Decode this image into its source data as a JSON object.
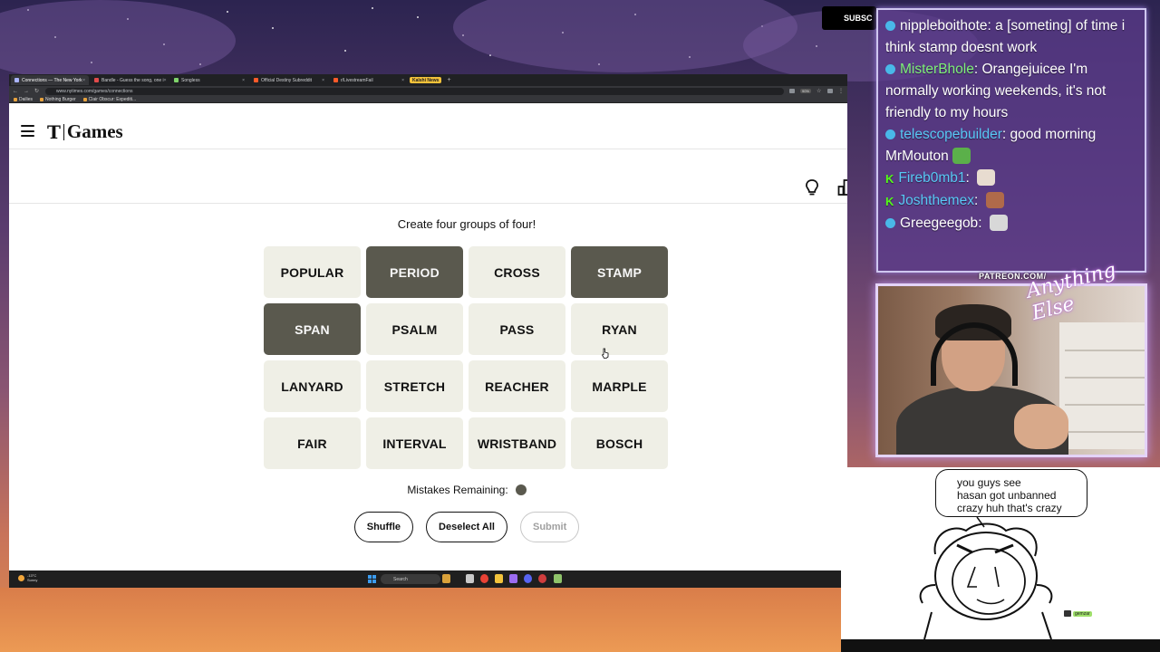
{
  "browser": {
    "tabs": [
      {
        "label": "Connections — The New York",
        "color": "#aab4ff",
        "active": true
      },
      {
        "label": "Bandle - Guess the song, one i",
        "color": "#e14b4b",
        "active": false
      },
      {
        "label": "Songless",
        "color": "#7fd36b",
        "active": false
      },
      {
        "label": "Official Destiny Subreddit",
        "color": "#ff5a2a",
        "active": false
      },
      {
        "label": "r/LivestreamFail",
        "color": "#ff5a2a",
        "active": false
      }
    ],
    "tab_pill": "Kalshi News",
    "url": "www.nytimes.com/games/connections",
    "zoom": "90%",
    "bookmarks": [
      "Dailies",
      "Nothing Burger",
      "Clair Obscur: Expediti..."
    ]
  },
  "header": {
    "logo_t": "T",
    "logo_text": "Games",
    "subscribe": "SUBSC"
  },
  "game": {
    "prompt": "Create four groups of four!",
    "tiles": [
      {
        "word": "POPULAR",
        "selected": false
      },
      {
        "word": "PERIOD",
        "selected": true
      },
      {
        "word": "CROSS",
        "selected": false
      },
      {
        "word": "STAMP",
        "selected": true
      },
      {
        "word": "SPAN",
        "selected": true
      },
      {
        "word": "PSALM",
        "selected": false
      },
      {
        "word": "PASS",
        "selected": false
      },
      {
        "word": "RYAN",
        "selected": false
      },
      {
        "word": "LANYARD",
        "selected": false
      },
      {
        "word": "STRETCH",
        "selected": false
      },
      {
        "word": "REACHER",
        "selected": false
      },
      {
        "word": "MARPLE",
        "selected": false
      },
      {
        "word": "FAIR",
        "selected": false
      },
      {
        "word": "INTERVAL",
        "selected": false
      },
      {
        "word": "WRISTBAND",
        "selected": false
      },
      {
        "word": "BOSCH",
        "selected": false
      }
    ],
    "mistakes_label": "Mistakes Remaining:",
    "mistakes_remaining": 1,
    "buttons": {
      "shuffle": "Shuffle",
      "deselect": "Deselect All",
      "submit": "Submit"
    },
    "selected_color": "#5a594e",
    "tile_color": "#efefe6"
  },
  "taskbar": {
    "temp": "-13°C",
    "weather": "Sunny",
    "search": "Search"
  },
  "chat": {
    "messages": [
      {
        "platform": "twitch",
        "user": "nipplebоithote",
        "user_display": "nippleboithote",
        "user_color": "#ffffff",
        "text": "a [someting] of time i think stamp doesnt work",
        "emote": null
      },
      {
        "platform": "twitch",
        "user_display": "MisterBhole",
        "user_color": "#7ff07a",
        "text": "Orangejuicee I'm normally working weekends, it's not friendly to my hours",
        "emote": null
      },
      {
        "platform": "twitch",
        "user_display": "telescopebuilder",
        "user_color": "#58c8f5",
        "text": "good morning MrMouton",
        "emote": "pepe"
      },
      {
        "platform": "kick",
        "user_display": "Fireb0mb1",
        "user_color": "#58c8f5",
        "text": "",
        "emote": "santa"
      },
      {
        "platform": "kick",
        "user_display": "Joshthemex",
        "user_color": "#58c8f5",
        "text": "",
        "emote": "face"
      },
      {
        "platform": "twitch",
        "user_display": "Greegeegob",
        "user_color": "#ffffff",
        "text": "",
        "emote": "heart"
      }
    ]
  },
  "overlay": {
    "patreon": "PATREON.COM/",
    "signature": "Anything Else",
    "bubble": [
      "you guys see",
      "hasan got unbanned",
      "crazy huh that's crazy"
    ],
    "tag": "gemzar"
  }
}
